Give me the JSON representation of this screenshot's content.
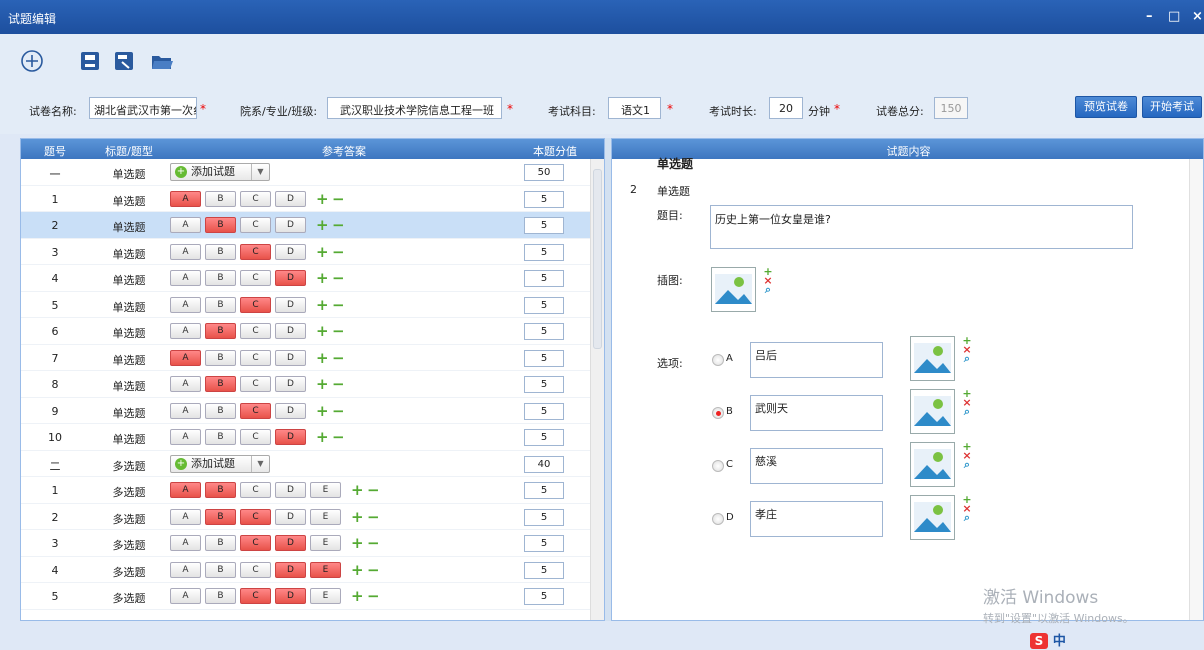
{
  "window": {
    "title": "试题编辑",
    "controls": [
      "–",
      "□",
      "×"
    ]
  },
  "toolbar": {
    "icons": [
      "add-icon",
      "save-icon",
      "save-as-icon",
      "open-folder-icon"
    ]
  },
  "form": {
    "paper_name_label": "试卷名称:",
    "paper_name_value": "湖北省武汉市第一次纟",
    "dept_label": "院系/专业/班级:",
    "dept_value": "武汉职业技术学院信息工程一班",
    "subject_label": "考试科目:",
    "subject_value": "语文1",
    "duration_label": "考试时长:",
    "duration_value": "20",
    "duration_unit": "分钟",
    "total_label": "试卷总分:",
    "total_value": "150",
    "required_mark": "*",
    "preview_button": "预览试卷",
    "start_button": "开始考试"
  },
  "left": {
    "headers": [
      "题号",
      "标题/题型",
      "参考答案",
      "本题分值"
    ],
    "add_question_label": "添加试题",
    "rows": [
      {
        "no": "一",
        "type": "单选题",
        "section": true,
        "score": "50"
      },
      {
        "no": "1",
        "type": "单选题",
        "opts": [
          "A",
          "B",
          "C",
          "D"
        ],
        "on": [
          0
        ],
        "score": "5"
      },
      {
        "no": "2",
        "type": "单选题",
        "opts": [
          "A",
          "B",
          "C",
          "D"
        ],
        "on": [
          1
        ],
        "score": "5",
        "sel": true
      },
      {
        "no": "3",
        "type": "单选题",
        "opts": [
          "A",
          "B",
          "C",
          "D"
        ],
        "on": [
          2
        ],
        "score": "5"
      },
      {
        "no": "4",
        "type": "单选题",
        "opts": [
          "A",
          "B",
          "C",
          "D"
        ],
        "on": [
          3
        ],
        "score": "5"
      },
      {
        "no": "5",
        "type": "单选题",
        "opts": [
          "A",
          "B",
          "C",
          "D"
        ],
        "on": [
          2
        ],
        "score": "5"
      },
      {
        "no": "6",
        "type": "单选题",
        "opts": [
          "A",
          "B",
          "C",
          "D"
        ],
        "on": [
          1
        ],
        "score": "5"
      },
      {
        "no": "7",
        "type": "单选题",
        "opts": [
          "A",
          "B",
          "C",
          "D"
        ],
        "on": [
          0
        ],
        "score": "5"
      },
      {
        "no": "8",
        "type": "单选题",
        "opts": [
          "A",
          "B",
          "C",
          "D"
        ],
        "on": [
          1
        ],
        "score": "5"
      },
      {
        "no": "9",
        "type": "单选题",
        "opts": [
          "A",
          "B",
          "C",
          "D"
        ],
        "on": [
          2
        ],
        "score": "5"
      },
      {
        "no": "10",
        "type": "单选题",
        "opts": [
          "A",
          "B",
          "C",
          "D"
        ],
        "on": [
          3
        ],
        "score": "5"
      },
      {
        "no": "二",
        "type": "多选题",
        "section": true,
        "score": "40"
      },
      {
        "no": "1",
        "type": "多选题",
        "opts": [
          "A",
          "B",
          "C",
          "D",
          "E"
        ],
        "on": [
          0,
          1
        ],
        "score": "5"
      },
      {
        "no": "2",
        "type": "多选题",
        "opts": [
          "A",
          "B",
          "C",
          "D",
          "E"
        ],
        "on": [
          1,
          2
        ],
        "score": "5"
      },
      {
        "no": "3",
        "type": "多选题",
        "opts": [
          "A",
          "B",
          "C",
          "D",
          "E"
        ],
        "on": [
          2,
          3
        ],
        "score": "5"
      },
      {
        "no": "4",
        "type": "多选题",
        "opts": [
          "A",
          "B",
          "C",
          "D",
          "E"
        ],
        "on": [
          3,
          4
        ],
        "score": "5"
      },
      {
        "no": "5",
        "type": "多选题",
        "opts": [
          "A",
          "B",
          "C",
          "D",
          "E"
        ],
        "on": [
          2,
          3
        ],
        "score": "5"
      }
    ]
  },
  "right": {
    "header": "试题内容",
    "section_title": "单选题",
    "q_no": "2",
    "q_type": "单选题",
    "stem_label": "题目:",
    "stem_value": "历史上第一位女皇是谁?",
    "image_label": "插图:",
    "options_label": "选项:",
    "options": [
      {
        "key": "A",
        "text": "吕后",
        "checked": false
      },
      {
        "key": "B",
        "text": "武则天",
        "checked": true
      },
      {
        "key": "C",
        "text": "慈溪",
        "checked": false
      },
      {
        "key": "D",
        "text": "孝庄",
        "checked": false
      }
    ]
  },
  "watermark": {
    "line1": "激活 Windows",
    "line2": "转到\"设置\"以激活 Windows。"
  },
  "tray": {
    "ime": "中"
  }
}
